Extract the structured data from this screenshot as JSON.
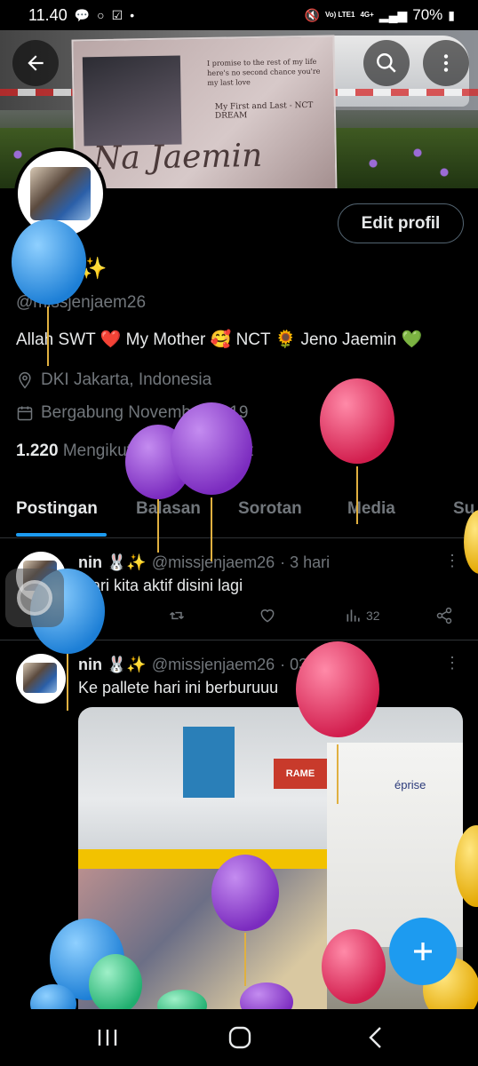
{
  "status_bar": {
    "time": "11.40",
    "network": "Vo) LTE1",
    "signal": "4G+",
    "battery": "70%"
  },
  "banner": {
    "card_quote": "I promise to the rest of my life here's no second chance you're my last love",
    "card_subtitle": "My First and Last - NCT DREAM",
    "card_name": "Na Jaemin"
  },
  "profile": {
    "name": "nin 🐰✨",
    "handle": "@missjenjaem26",
    "bio": "Allah SWT ❤️ My Mother 🥰 NCT 🌻 Jeno Jaemin 💚",
    "location": "DKI Jakarta, Indonesia",
    "joined": "Bergabung November 2019",
    "following_count": "1.220",
    "following_label": "Mengikuti",
    "followers_count": "612",
    "followers_label": "Pengikut",
    "edit_label": "Edit profil"
  },
  "tabs": [
    "Postingan",
    "Balasan",
    "Sorotan",
    "Media",
    "Su"
  ],
  "posts": [
    {
      "author": "nin 🐰✨",
      "handle": "@missjenjaem26",
      "time": "· 3 hari",
      "text": "Mari kita aktif disini lagi",
      "views": "32"
    },
    {
      "author": "nin 🐰✨",
      "handle": "@missjenjaem26",
      "time": "· 03 Des 23",
      "text": "Ke pallete hari ini berburuuu",
      "media_sign": "RAME",
      "media_store": "éprise"
    }
  ],
  "icons": [
    "back-arrow-icon",
    "search-icon",
    "more-vertical-icon",
    "location-pin-icon",
    "calendar-icon",
    "reply-icon",
    "retweet-icon",
    "like-icon",
    "views-icon",
    "share-icon",
    "plus-icon",
    "recents-icon",
    "home-icon",
    "nav-back-icon"
  ],
  "colors": {
    "accent": "#1d9bf0",
    "text": "#e7e9ea",
    "muted": "#71767b",
    "border": "#2f3336",
    "background": "#000000"
  }
}
